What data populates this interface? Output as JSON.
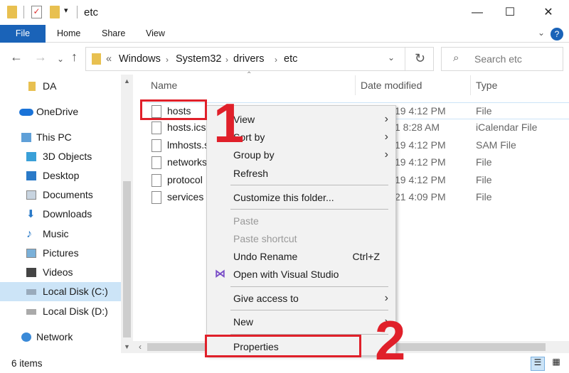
{
  "window": {
    "title": "etc",
    "minimize": "—",
    "maximize": "☐",
    "close": "✕"
  },
  "ribbon": {
    "tabs": [
      "File",
      "Home",
      "Share",
      "View"
    ],
    "help": "?"
  },
  "address": {
    "prefix": "«",
    "crumbs": [
      "Windows",
      "System32",
      "drivers",
      "etc"
    ],
    "search_placeholder": "Search etc"
  },
  "sidebar": {
    "items": [
      "DA",
      "OneDrive",
      "This PC",
      "3D Objects",
      "Desktop",
      "Documents",
      "Downloads",
      "Music",
      "Pictures",
      "Videos",
      "Local Disk (C:)",
      "Local Disk (D:)",
      "Network"
    ],
    "selected": "Local Disk (C:)"
  },
  "columns": {
    "name": "Name",
    "date": "Date modified",
    "type": "Type"
  },
  "files": [
    {
      "name": "hosts",
      "date": "19 4:12 PM",
      "type": "File"
    },
    {
      "name": "hosts.ics",
      "date": "1 8:28 AM",
      "type": "iCalendar File"
    },
    {
      "name": "lmhosts.s",
      "date": "19 4:12 PM",
      "type": "SAM File"
    },
    {
      "name": "networks",
      "date": "19 4:12 PM",
      "type": "File"
    },
    {
      "name": "protocol",
      "date": "19 4:12 PM",
      "type": "File"
    },
    {
      "name": "services",
      "date": "21 4:09 PM",
      "type": "File"
    }
  ],
  "context_menu": {
    "view": "View",
    "sort_by": "Sort by",
    "group_by": "Group by",
    "refresh": "Refresh",
    "customize": "Customize this folder...",
    "paste": "Paste",
    "paste_shortcut": "Paste shortcut",
    "undo_rename": "Undo Rename",
    "undo_shortcut": "Ctrl+Z",
    "open_vs": "Open with Visual Studio",
    "give_access": "Give access to",
    "new": "New",
    "properties": "Properties"
  },
  "annotations": {
    "step1": "1",
    "step2": "2"
  },
  "status": {
    "items": "6 items"
  },
  "colors": {
    "accent": "#1a63b8",
    "annotation": "#e0202a",
    "selected": "#cce4f7"
  }
}
